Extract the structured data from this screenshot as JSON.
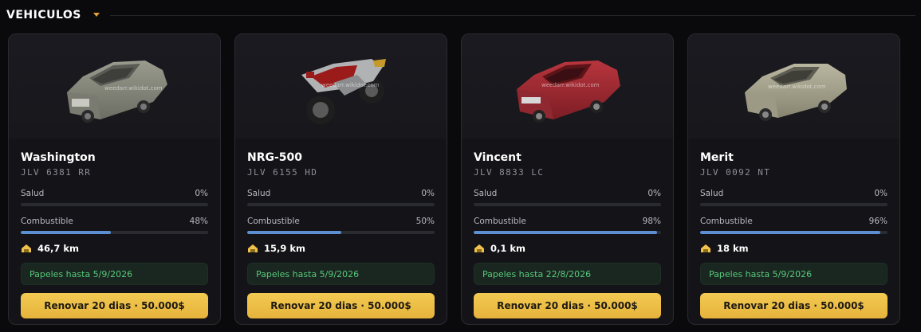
{
  "header": {
    "title": "VEHICULOS"
  },
  "colors": {
    "accent": "#e6b33b",
    "bar_fill": "#5b8fd1",
    "papers_text": "#57c97a",
    "card_bg": "#141418"
  },
  "vehicles": [
    {
      "name": "Washington",
      "plate": "JLV 6381 RR",
      "health_label": "Salud",
      "health_value": "0%",
      "health_pct": 0,
      "fuel_label": "Combustible",
      "fuel_value": "48%",
      "fuel_pct": 48,
      "mileage": "46,7 km",
      "papers": "Papeles hasta 5/9/2026",
      "renew_label": "Renovar 20 dias · 50.000$",
      "watermark": "weedarr.wikidot.com",
      "image_icon": "sedan-car-icon"
    },
    {
      "name": "NRG-500",
      "plate": "JLV 6155 HD",
      "health_label": "Salud",
      "health_value": "0%",
      "health_pct": 0,
      "fuel_label": "Combustible",
      "fuel_value": "50%",
      "fuel_pct": 50,
      "mileage": "15,9 km",
      "papers": "Papeles hasta 5/9/2026",
      "renew_label": "Renovar 20 dias · 50.000$",
      "watermark": "weedarr.wikidot.com",
      "image_icon": "motorcycle-icon"
    },
    {
      "name": "Vincent",
      "plate": "JLV 8833 LC",
      "health_label": "Salud",
      "health_value": "0%",
      "health_pct": 0,
      "fuel_label": "Combustible",
      "fuel_value": "98%",
      "fuel_pct": 98,
      "mileage": "0,1 km",
      "papers": "Papeles hasta 22/8/2026",
      "renew_label": "Renovar 20 dias · 50.000$",
      "watermark": "weedarr.wikidot.com",
      "image_icon": "red-sedan-icon"
    },
    {
      "name": "Merit",
      "plate": "JLV 0092 NT",
      "health_label": "Salud",
      "health_value": "0%",
      "health_pct": 0,
      "fuel_label": "Combustible",
      "fuel_value": "96%",
      "fuel_pct": 96,
      "mileage": "18 km",
      "papers": "Papeles hasta 5/9/2026",
      "renew_label": "Renovar 20 dias · 50.000$",
      "watermark": "weedarr.wikidot.com",
      "image_icon": "sedan-car-icon"
    }
  ]
}
